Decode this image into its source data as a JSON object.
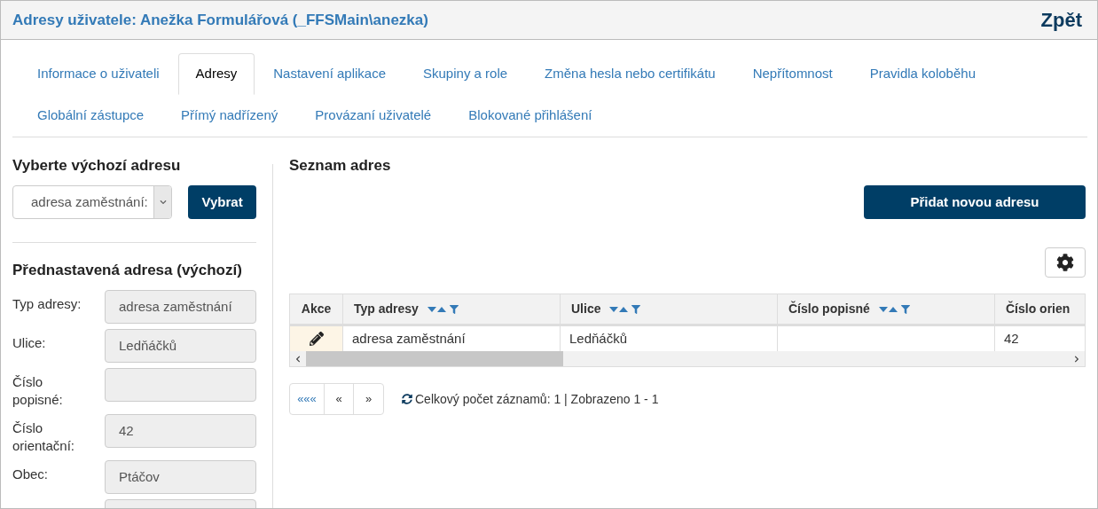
{
  "header": {
    "title": "Adresy uživatele: Anežka Formulářová (_FFSMain\\anezka)",
    "back": "Zpět"
  },
  "tabs": [
    {
      "label": "Informace o uživateli",
      "selected": false
    },
    {
      "label": "Adresy",
      "selected": true
    },
    {
      "label": "Nastavení aplikace",
      "selected": false
    },
    {
      "label": "Skupiny a role",
      "selected": false
    },
    {
      "label": "Změna hesla nebo certifikátu",
      "selected": false
    },
    {
      "label": "Nepřítomnost",
      "selected": false
    },
    {
      "label": "Pravidla koloběhu",
      "selected": false
    },
    {
      "label": "Globální zástupce",
      "selected": false
    },
    {
      "label": "Přímý nadřízený",
      "selected": false
    },
    {
      "label": "Provázaní uživatelé",
      "selected": false
    },
    {
      "label": "Blokované přihlášení",
      "selected": false
    }
  ],
  "default_address": {
    "heading": "Vyberte výchozí adresu",
    "select_value": "adresa zaměstnání:",
    "button": "Vybrat"
  },
  "preset": {
    "heading": "Přednastavená adresa (výchozí)",
    "fields": [
      {
        "kind": "field",
        "label": "Typ adresy:",
        "value": "adresa zaměstnání"
      },
      {
        "kind": "field",
        "label": "Ulice:",
        "value": "Ledňáčků"
      },
      {
        "kind": "field",
        "label": "Číslo popisné:"
      },
      {
        "kind": "field",
        "label": "Číslo orientační:",
        "value": "42"
      },
      {
        "kind": "field",
        "label": "Obec:",
        "value": "Ptáčov"
      },
      {
        "kind": "field"
      }
    ]
  },
  "list": {
    "heading": "Seznam adres",
    "add_button": "Přidat novou adresu",
    "columns": [
      {
        "label": "Akce",
        "sortable": false
      },
      {
        "label": "Typ adresy",
        "sortable": true
      },
      {
        "label": "Ulice",
        "sortable": true
      },
      {
        "label": "Číslo popisné",
        "sortable": true
      },
      {
        "label": "Číslo orien",
        "sortable": false
      }
    ],
    "rows": [
      [
        "",
        "adresa zaměstnání",
        "Ledňáčků",
        "",
        "42"
      ]
    ],
    "pager": {
      "first": "«««",
      "prev": "«",
      "next": "»",
      "summary": "Celkový počet záznamů: 1 | Zobrazeno 1 - 1"
    }
  }
}
